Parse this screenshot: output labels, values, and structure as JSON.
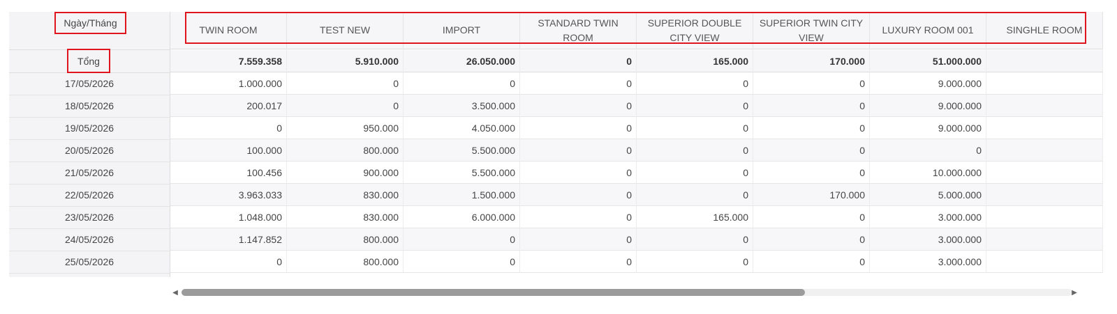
{
  "left": {
    "header_label": "Ngày/Tháng",
    "total_label": "Tổng",
    "dates": [
      "17/05/2026",
      "18/05/2026",
      "19/05/2026",
      "20/05/2026",
      "21/05/2026",
      "22/05/2026",
      "23/05/2026",
      "24/05/2026",
      "25/05/2026"
    ]
  },
  "columns": [
    "TWIN ROOM",
    "TEST NEW",
    "IMPORT",
    "STANDARD TWIN ROOM",
    "SUPERIOR DOUBLE CITY VIEW",
    "SUPERIOR TWIN CITY VIEW",
    "LUXURY ROOM 001",
    "SINGHLE ROOM"
  ],
  "totals": [
    "7.559.358",
    "5.910.000",
    "26.050.000",
    "0",
    "165.000",
    "170.000",
    "51.000.000",
    ""
  ],
  "rows": [
    [
      "1.000.000",
      "0",
      "0",
      "0",
      "0",
      "0",
      "9.000.000",
      ""
    ],
    [
      "200.017",
      "0",
      "3.500.000",
      "0",
      "0",
      "0",
      "9.000.000",
      ""
    ],
    [
      "0",
      "950.000",
      "4.050.000",
      "0",
      "0",
      "0",
      "9.000.000",
      ""
    ],
    [
      "100.000",
      "800.000",
      "5.500.000",
      "0",
      "0",
      "0",
      "0",
      ""
    ],
    [
      "100.456",
      "900.000",
      "5.500.000",
      "0",
      "0",
      "0",
      "10.000.000",
      ""
    ],
    [
      "3.963.033",
      "830.000",
      "1.500.000",
      "0",
      "0",
      "170.000",
      "5.000.000",
      ""
    ],
    [
      "1.048.000",
      "830.000",
      "6.000.000",
      "0",
      "165.000",
      "0",
      "3.000.000",
      ""
    ],
    [
      "1.147.852",
      "800.000",
      "0",
      "0",
      "0",
      "0",
      "3.000.000",
      ""
    ],
    [
      "0",
      "800.000",
      "0",
      "0",
      "0",
      "0",
      "3.000.000",
      ""
    ]
  ],
  "scrollbar": {
    "left_arrow": "◀",
    "right_arrow": "▶",
    "position_fraction": 0.0,
    "visible_fraction": 0.7
  },
  "colors": {
    "highlight": "#e0141c"
  }
}
